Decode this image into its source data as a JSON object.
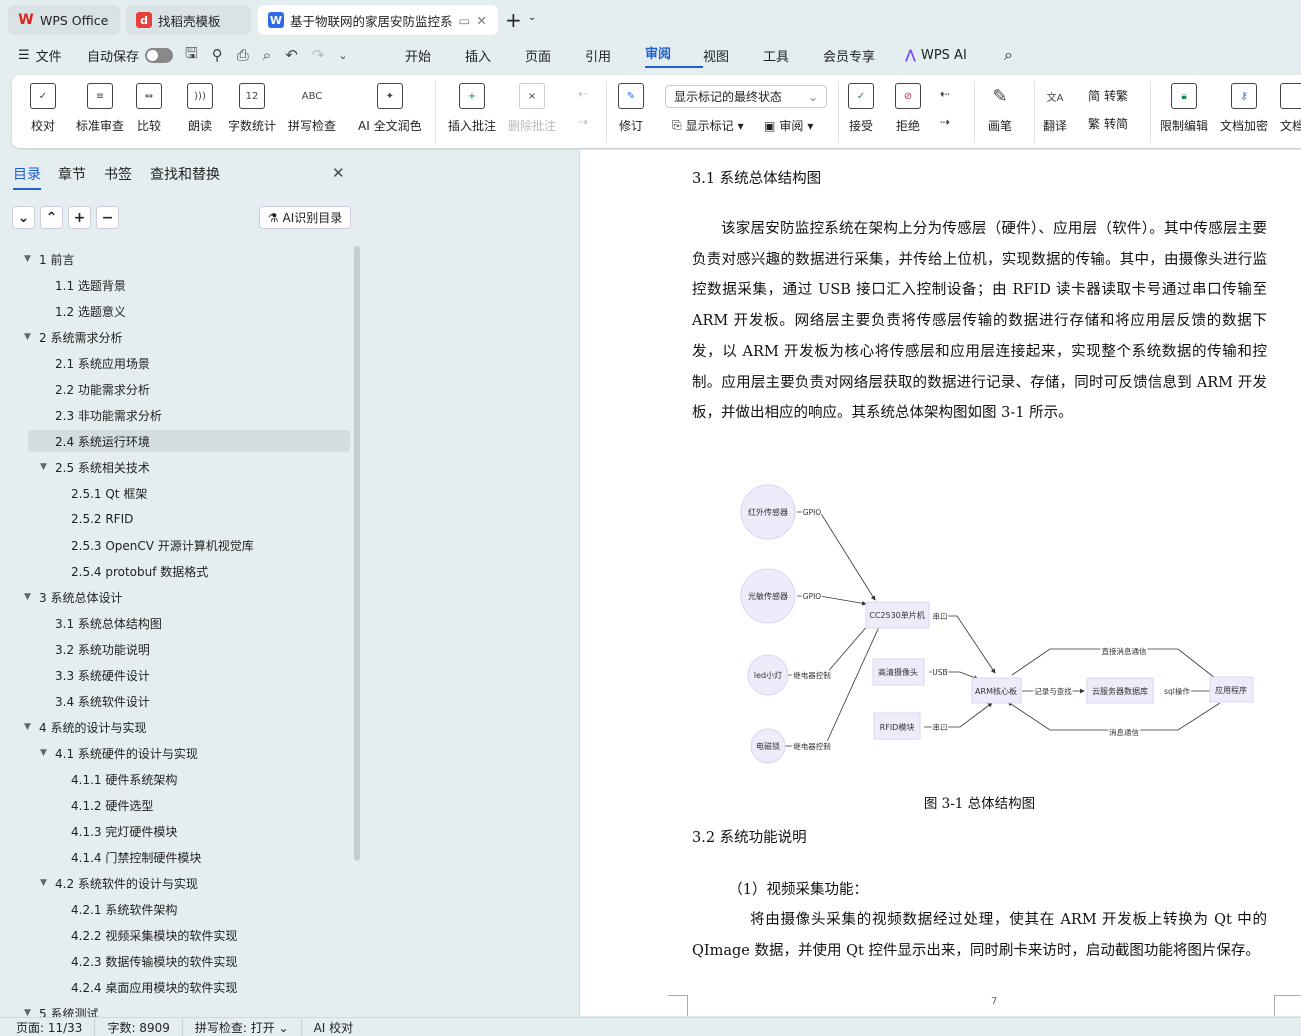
{
  "tabs": [
    {
      "label": "WPS Office",
      "color": "#e2231a"
    },
    {
      "label": "找稻壳模板",
      "color": "#e8413c"
    },
    {
      "label": "基于物联网的家居安防监控系",
      "color": "#2e6be6"
    }
  ],
  "menu": {
    "file": "文件",
    "autosave": "自动保存",
    "autosave_on": false,
    "items": [
      "开始",
      "插入",
      "页面",
      "引用",
      "审阅",
      "视图",
      "工具",
      "会员专享"
    ],
    "active": "审阅",
    "wps_ai": "WPS AI"
  },
  "ribbon": {
    "buttons": [
      "校对",
      "标准审查",
      "比较",
      "朗读",
      "字数统计",
      "拼写检查",
      "AI 全文润色",
      "插入批注",
      "删除批注"
    ],
    "revise": "修订",
    "markup_select": "显示标记的最终状态",
    "show_markup": "显示标记",
    "review": "审阅",
    "accept": "接受",
    "reject": "拒绝",
    "pen": "画笔",
    "translate": "翻译",
    "to_traditional": "转繁",
    "to_simplified": "转简",
    "restrict": "限制编辑",
    "encrypt": "文档加密",
    "more": "文档"
  },
  "panel": {
    "tabs": [
      "目录",
      "章节",
      "书签",
      "查找和替换"
    ],
    "active_tab": "目录",
    "ai_toc": "AI识别目录",
    "toc": [
      {
        "label": "1 前言",
        "level": 1,
        "expand": true
      },
      {
        "label": "1.1  选题背景",
        "level": 2
      },
      {
        "label": "1.2  选题意义",
        "level": 2
      },
      {
        "label": "2  系统需求分析",
        "level": 1,
        "expand": true
      },
      {
        "label": "2.1  系统应用场景",
        "level": 2
      },
      {
        "label": "2.2  功能需求分析",
        "level": 2
      },
      {
        "label": "2.3  非功能需求分析",
        "level": 2
      },
      {
        "label": "2.4  系统运行环境",
        "level": 2,
        "selected": true
      },
      {
        "label": "2.5  系统相关技术",
        "level": 2,
        "expand": true
      },
      {
        "label": "2.5.1 Qt 框架",
        "level": 3
      },
      {
        "label": "2.5.2 RFID",
        "level": 3
      },
      {
        "label": "2.5.3 OpenCV 开源计算机视觉库",
        "level": 3
      },
      {
        "label": "2.5.4 protobuf 数据格式",
        "level": 3
      },
      {
        "label": "3  系统总体设计",
        "level": 1,
        "expand": true
      },
      {
        "label": "3.1  系统总体结构图",
        "level": 2
      },
      {
        "label": "3.2  系统功能说明",
        "level": 2
      },
      {
        "label": "3.3  系统硬件设计",
        "level": 2
      },
      {
        "label": "3.4  系统软件设计",
        "level": 2
      },
      {
        "label": "4  系统的设计与实现",
        "level": 1,
        "expand": true
      },
      {
        "label": "4.1  系统硬件的设计与实现",
        "level": 2,
        "expand": true
      },
      {
        "label": "4.1.1 硬件系统架构",
        "level": 3
      },
      {
        "label": "4.1.2  硬件选型",
        "level": 3
      },
      {
        "label": "4.1.3 完灯硬件模块",
        "level": 3
      },
      {
        "label": "4.1.4 门禁控制硬件模块",
        "level": 3
      },
      {
        "label": "4.2  系统软件的设计与实现",
        "level": 2,
        "expand": true
      },
      {
        "label": "4.2.1  系统软件架构",
        "level": 3
      },
      {
        "label": "4.2.2 视频采集模块的软件实现",
        "level": 3
      },
      {
        "label": "4.2.3 数据传输模块的软件实现",
        "level": 3
      },
      {
        "label": "4.2.4 桌面应用模块的软件实现",
        "level": 3
      },
      {
        "label": "5  系统测试",
        "level": 1,
        "expand": true
      }
    ]
  },
  "document": {
    "h31": "3.1  系统总体结构图",
    "p1": "该家居安防监控系统在架构上分为传感层（硬件）、应用层（软件）。其中传感层主要负责对感兴趣的数据进行采集，并传给上位机，实现数据的传输。其中，由摄像头进行监控数据采集，通过 USB 接口汇入控制设备；由 RFID 读卡器读取卡号通过串口传输至 ARM 开发板。网络层主要负责将传感层传输的数据进行存储和将应用层反馈的数据下发，以 ARM 开发板为核心将传感层和应用层连接起来，实现整个系统数据的传输和控制。应用层主要负责对网络层获取的数据进行记录、存储，同时可反馈信息到 ARM 开发板，并做出相应的响应。其系统总体架构图如图 3-1 所示。",
    "diagram": {
      "nodes": {
        "ir": "红外传感器",
        "light": "光敏传感器",
        "led": "led小灯",
        "lock": "电磁锁",
        "cc2530": "CC2530单片机",
        "camera": "高清摄像头",
        "rfid": "RFID模块",
        "arm": "ARM核心板",
        "cloud": "云服务器数据库",
        "app": "应用程序"
      },
      "edges": {
        "gpio1": "GPIO",
        "gpio2": "GPIO",
        "relay1": "继电器控制",
        "relay2": "继电器控制",
        "serial1": "串口",
        "usb": "USB",
        "serial2": "串口",
        "direct": "直接消息通信",
        "record": "记录与查找",
        "sql": "sql操作",
        "msg": "消息通信"
      }
    },
    "caption": "图 3-1  总体结构图",
    "h32": "3.2  系统功能说明",
    "item1": "（1）视频采集功能：",
    "p2": "将由摄像头采集的视频数据经过处理，使其在 ARM 开发板上转换为 Qt 中的 QImage 数据，并使用 Qt 控件显示出来，同时刷卡来访时，启动截图功能将图片保存。",
    "page_number": "7"
  },
  "status": {
    "page": "页面: 11/33",
    "words": "字数: 8909",
    "spell": "拼写检查: 打开",
    "ai": "AI 校对"
  }
}
